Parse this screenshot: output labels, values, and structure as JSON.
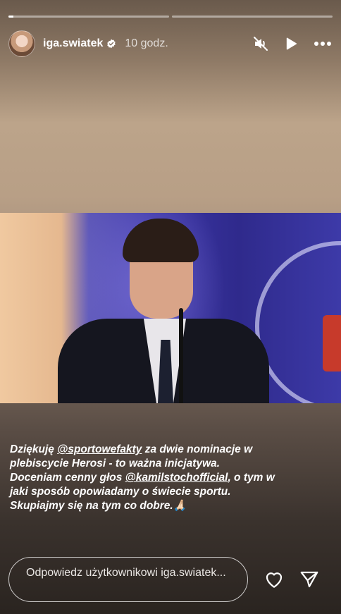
{
  "progress": {
    "segments": 2,
    "current_fill": 0.03
  },
  "header": {
    "username": "iga.swiatek",
    "time": "10 godz.",
    "icons": [
      "verified-badge-icon",
      "muted-speaker-icon",
      "play-icon",
      "more-icon"
    ]
  },
  "caption": {
    "line1_pre": "Dziękuję ",
    "line1_mention": "@sportowefakty",
    "line1_post": " za dwie nominacje w",
    "line2": "plebiscycie Herosi  - to ważna inicjatywa.",
    "line3_pre": "Doceniam cenny głos ",
    "line3_mention": "@kamilstochofficial",
    "line3_post": ", o tym w",
    "line4": "jaki sposób opowiadamy o świecie sportu.",
    "line5": "Skupiajmy się na tym co dobre.",
    "emoji": "🙏🏻"
  },
  "reply": {
    "placeholder": "Odpowiedz użytkownikowi iga.swiatek..."
  },
  "actions": {
    "icons": [
      "heart-icon",
      "send-icon"
    ]
  }
}
